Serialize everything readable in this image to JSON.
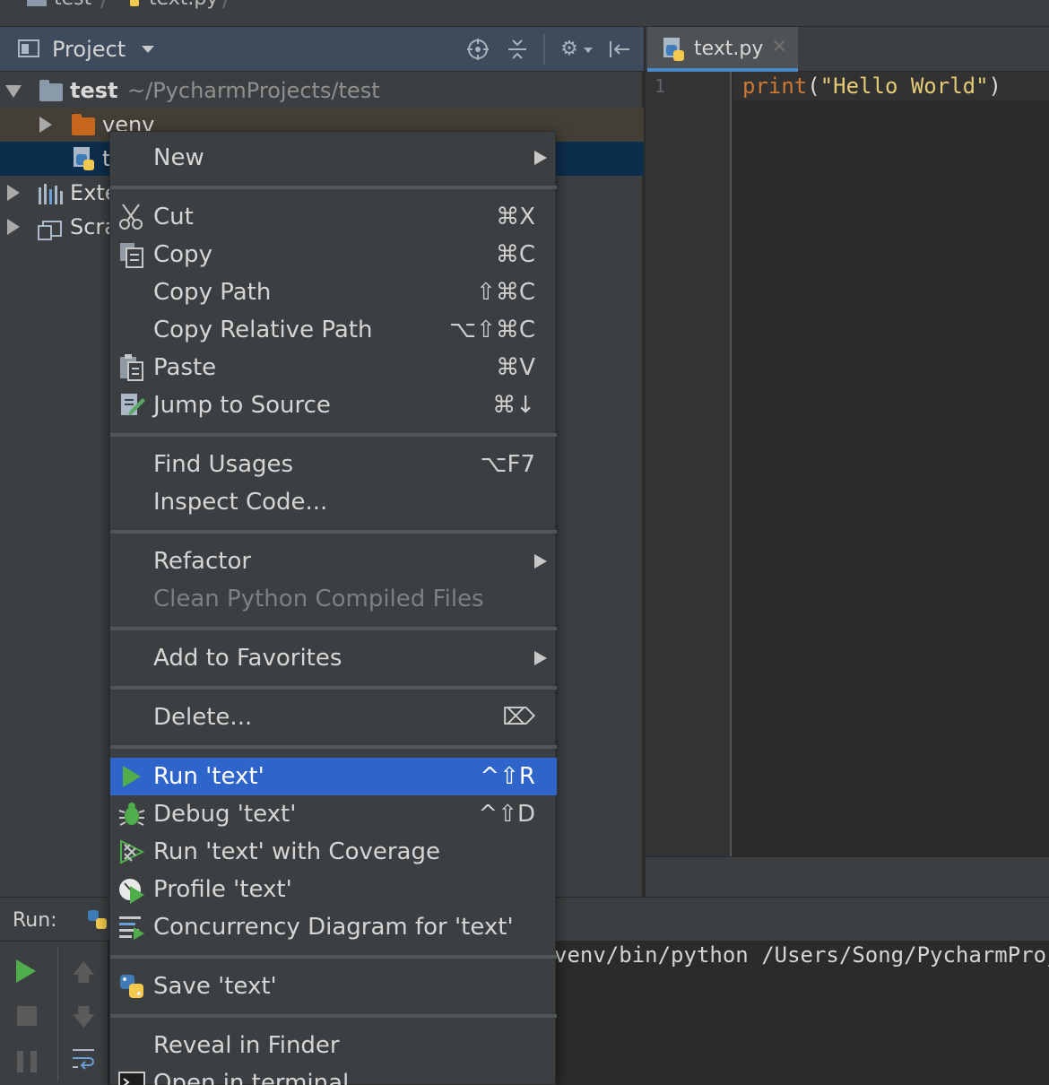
{
  "breadcrumb": {
    "items": [
      "test",
      "text.py"
    ]
  },
  "project_panel": {
    "title": "Project",
    "tree": [
      {
        "label": "test",
        "path": "~/PycharmProjects/test"
      },
      {
        "label": "venv"
      },
      {
        "label": "t"
      },
      {
        "label": "Exte"
      },
      {
        "label": "Scra"
      }
    ]
  },
  "editor": {
    "tab_label": "text.py",
    "line_number": "1",
    "code": {
      "keyword": "print",
      "open": "(",
      "string": "\"Hello World\"",
      "close": ")"
    }
  },
  "run_panel": {
    "label": "Run:",
    "console_line": "venv/bin/python /Users/Song/PycharmProje"
  },
  "context_menu": {
    "items": {
      "new": {
        "label": "New"
      },
      "cut": {
        "label": "Cut",
        "shortcut": "⌘X"
      },
      "copy": {
        "label": "Copy",
        "shortcut": "⌘C"
      },
      "copy_path": {
        "label": "Copy Path",
        "shortcut": "⇧⌘C"
      },
      "copy_relative_path": {
        "label": "Copy Relative Path",
        "shortcut": "⌥⇧⌘C"
      },
      "paste": {
        "label": "Paste",
        "shortcut": "⌘V"
      },
      "jump_to_source": {
        "label": "Jump to Source",
        "shortcut": "⌘↓"
      },
      "find_usages": {
        "label": "Find Usages",
        "shortcut": "⌥F7"
      },
      "inspect_code": {
        "label": "Inspect Code..."
      },
      "refactor": {
        "label": "Refactor"
      },
      "clean_python": {
        "label": "Clean Python Compiled Files"
      },
      "add_to_favorites": {
        "label": "Add to Favorites"
      },
      "delete": {
        "label": "Delete...",
        "shortcut": "⌦"
      },
      "run": {
        "label": "Run 'text'",
        "shortcut": "^⇧R"
      },
      "debug": {
        "label": "Debug 'text'",
        "shortcut": "^⇧D"
      },
      "run_coverage": {
        "label": "Run 'text' with Coverage"
      },
      "profile": {
        "label": "Profile 'text'"
      },
      "concurrency": {
        "label": "Concurrency Diagram for 'text'"
      },
      "save": {
        "label": "Save 'text'"
      },
      "reveal": {
        "label": "Reveal in Finder"
      },
      "terminal": {
        "label": "Open in terminal"
      }
    }
  },
  "colors": {
    "menu_bg": "#3c3f41",
    "selection": "#2f65ca",
    "panel_header": "#3d4b5c",
    "tree_selection": "#0d2d4c",
    "keyword": "#cc7832",
    "string": "#e6cb76"
  }
}
